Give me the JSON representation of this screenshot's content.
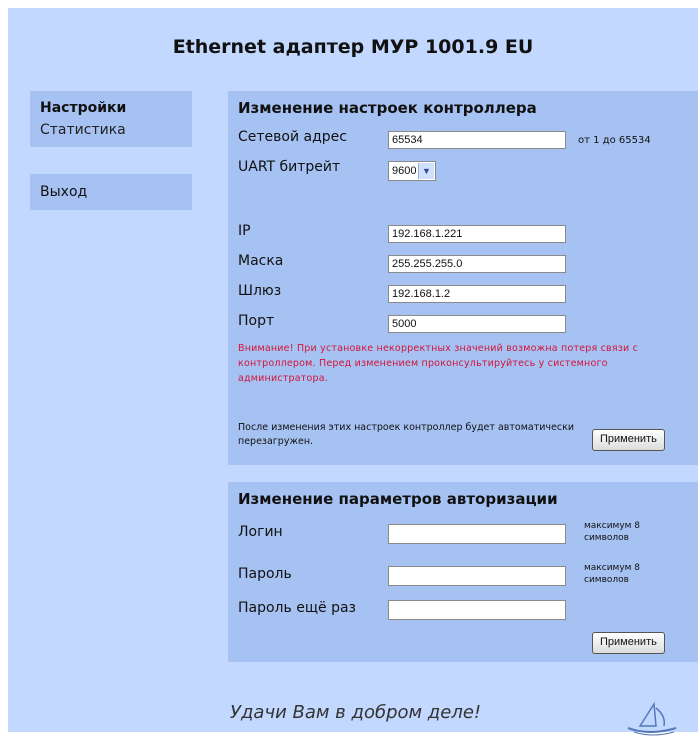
{
  "header": {
    "title": "Ethernet адаптер МУР 1001.9 EU"
  },
  "sidebar": {
    "group1": [
      "Настройки",
      "Статистика"
    ],
    "group2": [
      "Выход"
    ]
  },
  "controller": {
    "heading": "Изменение настроек контроллера",
    "address_label": "Сетевой адрес",
    "address_value": "65534",
    "address_hint": "от 1 до 65534",
    "baud_label": "UART битрейт",
    "baud_value": "9600",
    "ip_label": "IP",
    "ip_value": "192.168.1.221",
    "mask_label": "Маска",
    "mask_value": "255.255.255.0",
    "gateway_label": "Шлюз",
    "gateway_value": "192.168.1.2",
    "port_label": "Порт",
    "port_value": "5000",
    "warning": "Внимание! При установке некорректных значений возможна потеря связи с контроллером. Перед изменением проконсультируйтесь у системного администратора.",
    "note": "После изменения этих настроек контроллер будет автоматически перезагружен.",
    "apply_label": "Применить"
  },
  "auth": {
    "heading": "Изменение параметров авторизации",
    "login_label": "Логин",
    "login_value": "",
    "login_hint": "максимум 8 символов",
    "password_label": "Пароль",
    "password_value": "",
    "password_hint": "максимум 8 символов",
    "password2_label": "Пароль ещё раз",
    "password2_value": "",
    "apply_label": "Применить"
  },
  "footer": {
    "slogan": "Удачи Вам в добром деле!"
  },
  "colors": {
    "page_bg": "#c3d8ff",
    "panel_bg": "#a6c2f2",
    "warning": "#d4143a"
  },
  "icons": {
    "logo": "sailing-ship-logo",
    "dropdown": "chevron-down-icon"
  }
}
